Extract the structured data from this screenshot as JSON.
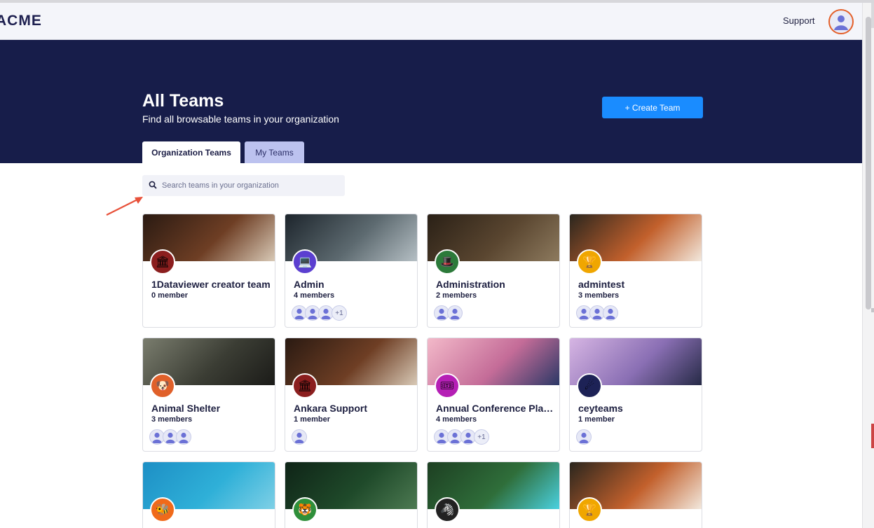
{
  "header": {
    "logo": "ACME",
    "support": "Support"
  },
  "hero": {
    "title": "All Teams",
    "subtitle": "Find all browsable teams in your organization",
    "create_button": "+ Create Team"
  },
  "tabs": [
    {
      "label": "Organization Teams",
      "active": true
    },
    {
      "label": "My Teams",
      "active": false
    }
  ],
  "search": {
    "placeholder": "Search teams in your organization"
  },
  "teams": [
    {
      "name": "1Dataviewer creator team",
      "count": "0 member",
      "icon": "museum-icon",
      "icon_bg": "#8b1e1e",
      "banner": [
        "#2a1a12",
        "#6e3e24",
        "#d8c9b6"
      ]
    },
    {
      "name": "Admin",
      "count": "4 members",
      "icon": "laptop-icon",
      "icon_bg": "#5b3fd0",
      "banner": [
        "#1d252c",
        "#5d6a70",
        "#b5bfc4"
      ],
      "more": "+1"
    },
    {
      "name": "Administration",
      "count": "2 members",
      "icon": "top-hat-icon",
      "icon_bg": "#2c7a3a",
      "banner": [
        "#2a2016",
        "#5a4630",
        "#8d7a5e"
      ]
    },
    {
      "name": "admintest",
      "count": "3 members",
      "icon": "trophy-icon",
      "icon_bg": "#f0a600",
      "banner": [
        "#2a261e",
        "#c2602c",
        "#f2e8dd"
      ]
    },
    {
      "name": "Animal Shelter",
      "count": "3 members",
      "icon": "dog-icon",
      "icon_bg": "#e0602a",
      "banner": [
        "#7a7d6e",
        "#3b3d34",
        "#1b1b18"
      ]
    },
    {
      "name": "Ankara Support",
      "count": "1 member",
      "icon": "museum-icon",
      "icon_bg": "#8b1e1e",
      "banner": [
        "#2a1a12",
        "#6e3e24",
        "#d8c9b6"
      ]
    },
    {
      "name": "Annual Conference Pla…",
      "count": "4 members",
      "icon": "ticket-icon",
      "icon_bg": "#b51fb5",
      "banner": [
        "#f3b9c9",
        "#c46c98",
        "#2b3866"
      ],
      "more": "+1"
    },
    {
      "name": "ceyteams",
      "count": "1 member",
      "icon": "comet-icon",
      "icon_bg": "#1d2256",
      "banner": [
        "#d6b5e3",
        "#8a6fb4",
        "#262a46"
      ]
    },
    {
      "name": "",
      "count": "",
      "icon": "bee-icon",
      "icon_bg": "#f06a1a",
      "banner": [
        "#1d8fc5",
        "#2fb0d8",
        "#7fd0e6"
      ]
    },
    {
      "name": "",
      "count": "",
      "icon": "tiger-icon",
      "icon_bg": "#2f8f3a",
      "banner": [
        "#0f2417",
        "#1f4a2a",
        "#4d7a52"
      ]
    },
    {
      "name": "",
      "count": "",
      "icon": "zebra-icon",
      "icon_bg": "#222222",
      "banner": [
        "#1d3f22",
        "#2f6e3a",
        "#4ad0df"
      ]
    },
    {
      "name": "",
      "count": "",
      "icon": "trophy-icon",
      "icon_bg": "#f0a600",
      "banner": [
        "#2a261e",
        "#c2602c",
        "#f2e8dd"
      ]
    }
  ]
}
